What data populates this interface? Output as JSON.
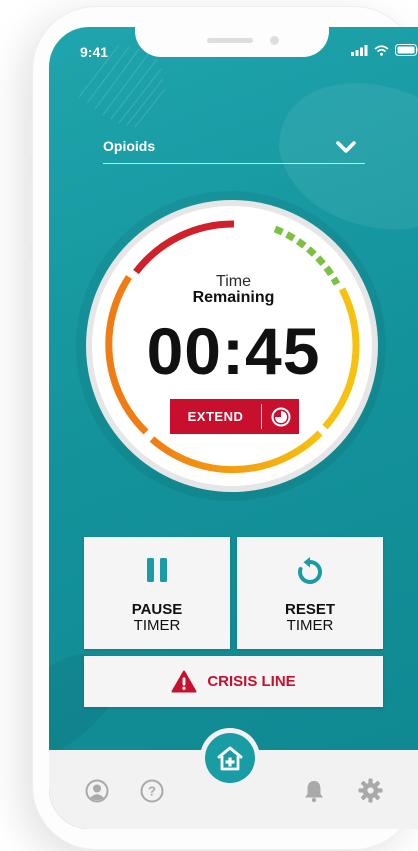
{
  "status_bar": {
    "time": "9:41"
  },
  "dropdown": {
    "selected": "Opioids"
  },
  "timer": {
    "time_label": "Time",
    "remaining_label": "Remaining",
    "countdown": "00:45",
    "extend_label": "EXTEND"
  },
  "controls": {
    "pause": {
      "line1": "PAUSE",
      "line2": "TIMER"
    },
    "reset": {
      "line1": "RESET",
      "line2": "TIMER"
    },
    "crisis": {
      "label": "CRISIS LINE"
    }
  },
  "bottom_nav": {
    "icons": [
      "profile-icon",
      "help-icon",
      "home-icon",
      "bell-icon",
      "gear-icon"
    ]
  },
  "colors": {
    "teal": "#1a9ca5",
    "brand_red": "#c8102e",
    "ring_red": "#d0202a",
    "ring_orange": "#f07d13",
    "ring_yellow": "#f6c20f",
    "ring_green": "#7cc242"
  }
}
